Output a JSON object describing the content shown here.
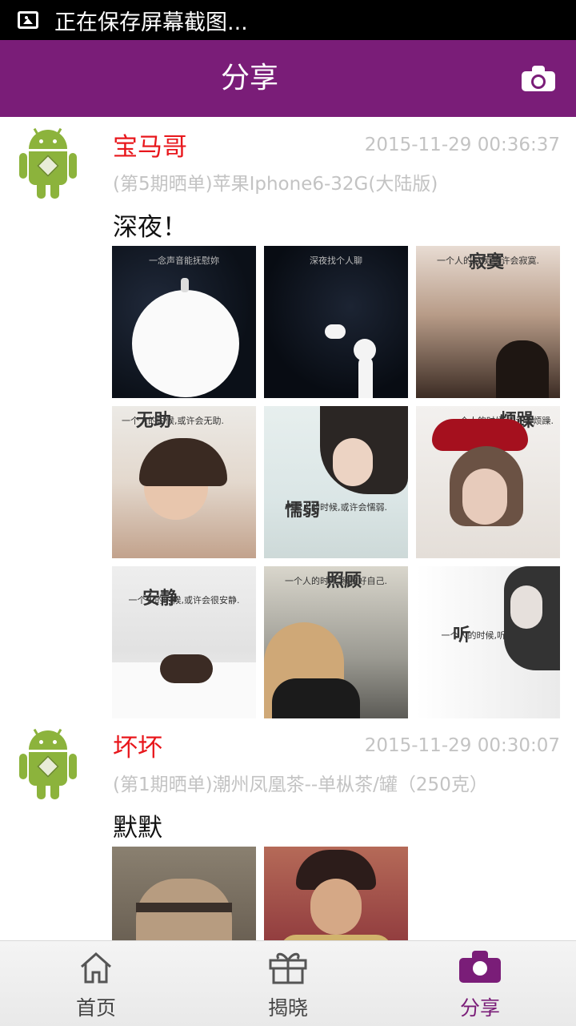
{
  "status_bar": {
    "notification_text": "正在保存屏幕截图..."
  },
  "app_bar": {
    "title": "分享",
    "action_icon": "camera-icon"
  },
  "posts": [
    {
      "user_name": "宝马哥",
      "timestamp": "2015-11-29 00:36:37",
      "product": "(第5期晒单)苹果Iphone6-32G(大陆版)",
      "content": "深夜！",
      "images": [
        {
          "caption": "一念声音能抚慰妳",
          "title": ""
        },
        {
          "caption": "深夜找个人聊",
          "title": ""
        },
        {
          "caption": "一个人的时候,或许会寂寞.",
          "title": "寂寞"
        },
        {
          "caption": "一个人的时候,或许会无助.",
          "title": "无助"
        },
        {
          "caption": "一个人的时候,或许会懦弱.",
          "title": "懦弱"
        },
        {
          "caption": "一个人的时候,或许会烦躁.",
          "title": "烦躁"
        },
        {
          "caption": "一个人的时候,或许会很安静.",
          "title": "安静"
        },
        {
          "caption": "一个人的时候,照顾好自己.",
          "title": "照顾"
        },
        {
          "caption": "一个人的时候,听一首歌.",
          "title": "听"
        }
      ]
    },
    {
      "user_name": "坏坏",
      "timestamp": "2015-11-29 00:30:07",
      "product": "(第1期晒单)潮州凤凰茶--单枞茶/罐（250克）",
      "content": "默默",
      "images": [
        {
          "caption": "",
          "title": ""
        },
        {
          "caption": "",
          "title": ""
        }
      ]
    }
  ],
  "tabs": [
    {
      "label": "首页",
      "icon": "home-icon"
    },
    {
      "label": "揭晓",
      "icon": "gift-icon"
    },
    {
      "label": "分享",
      "icon": "camera-icon"
    }
  ],
  "colors": {
    "primary": "#7a1d78",
    "user_name": "#e8171c",
    "meta_text": "#c3c3c3"
  }
}
